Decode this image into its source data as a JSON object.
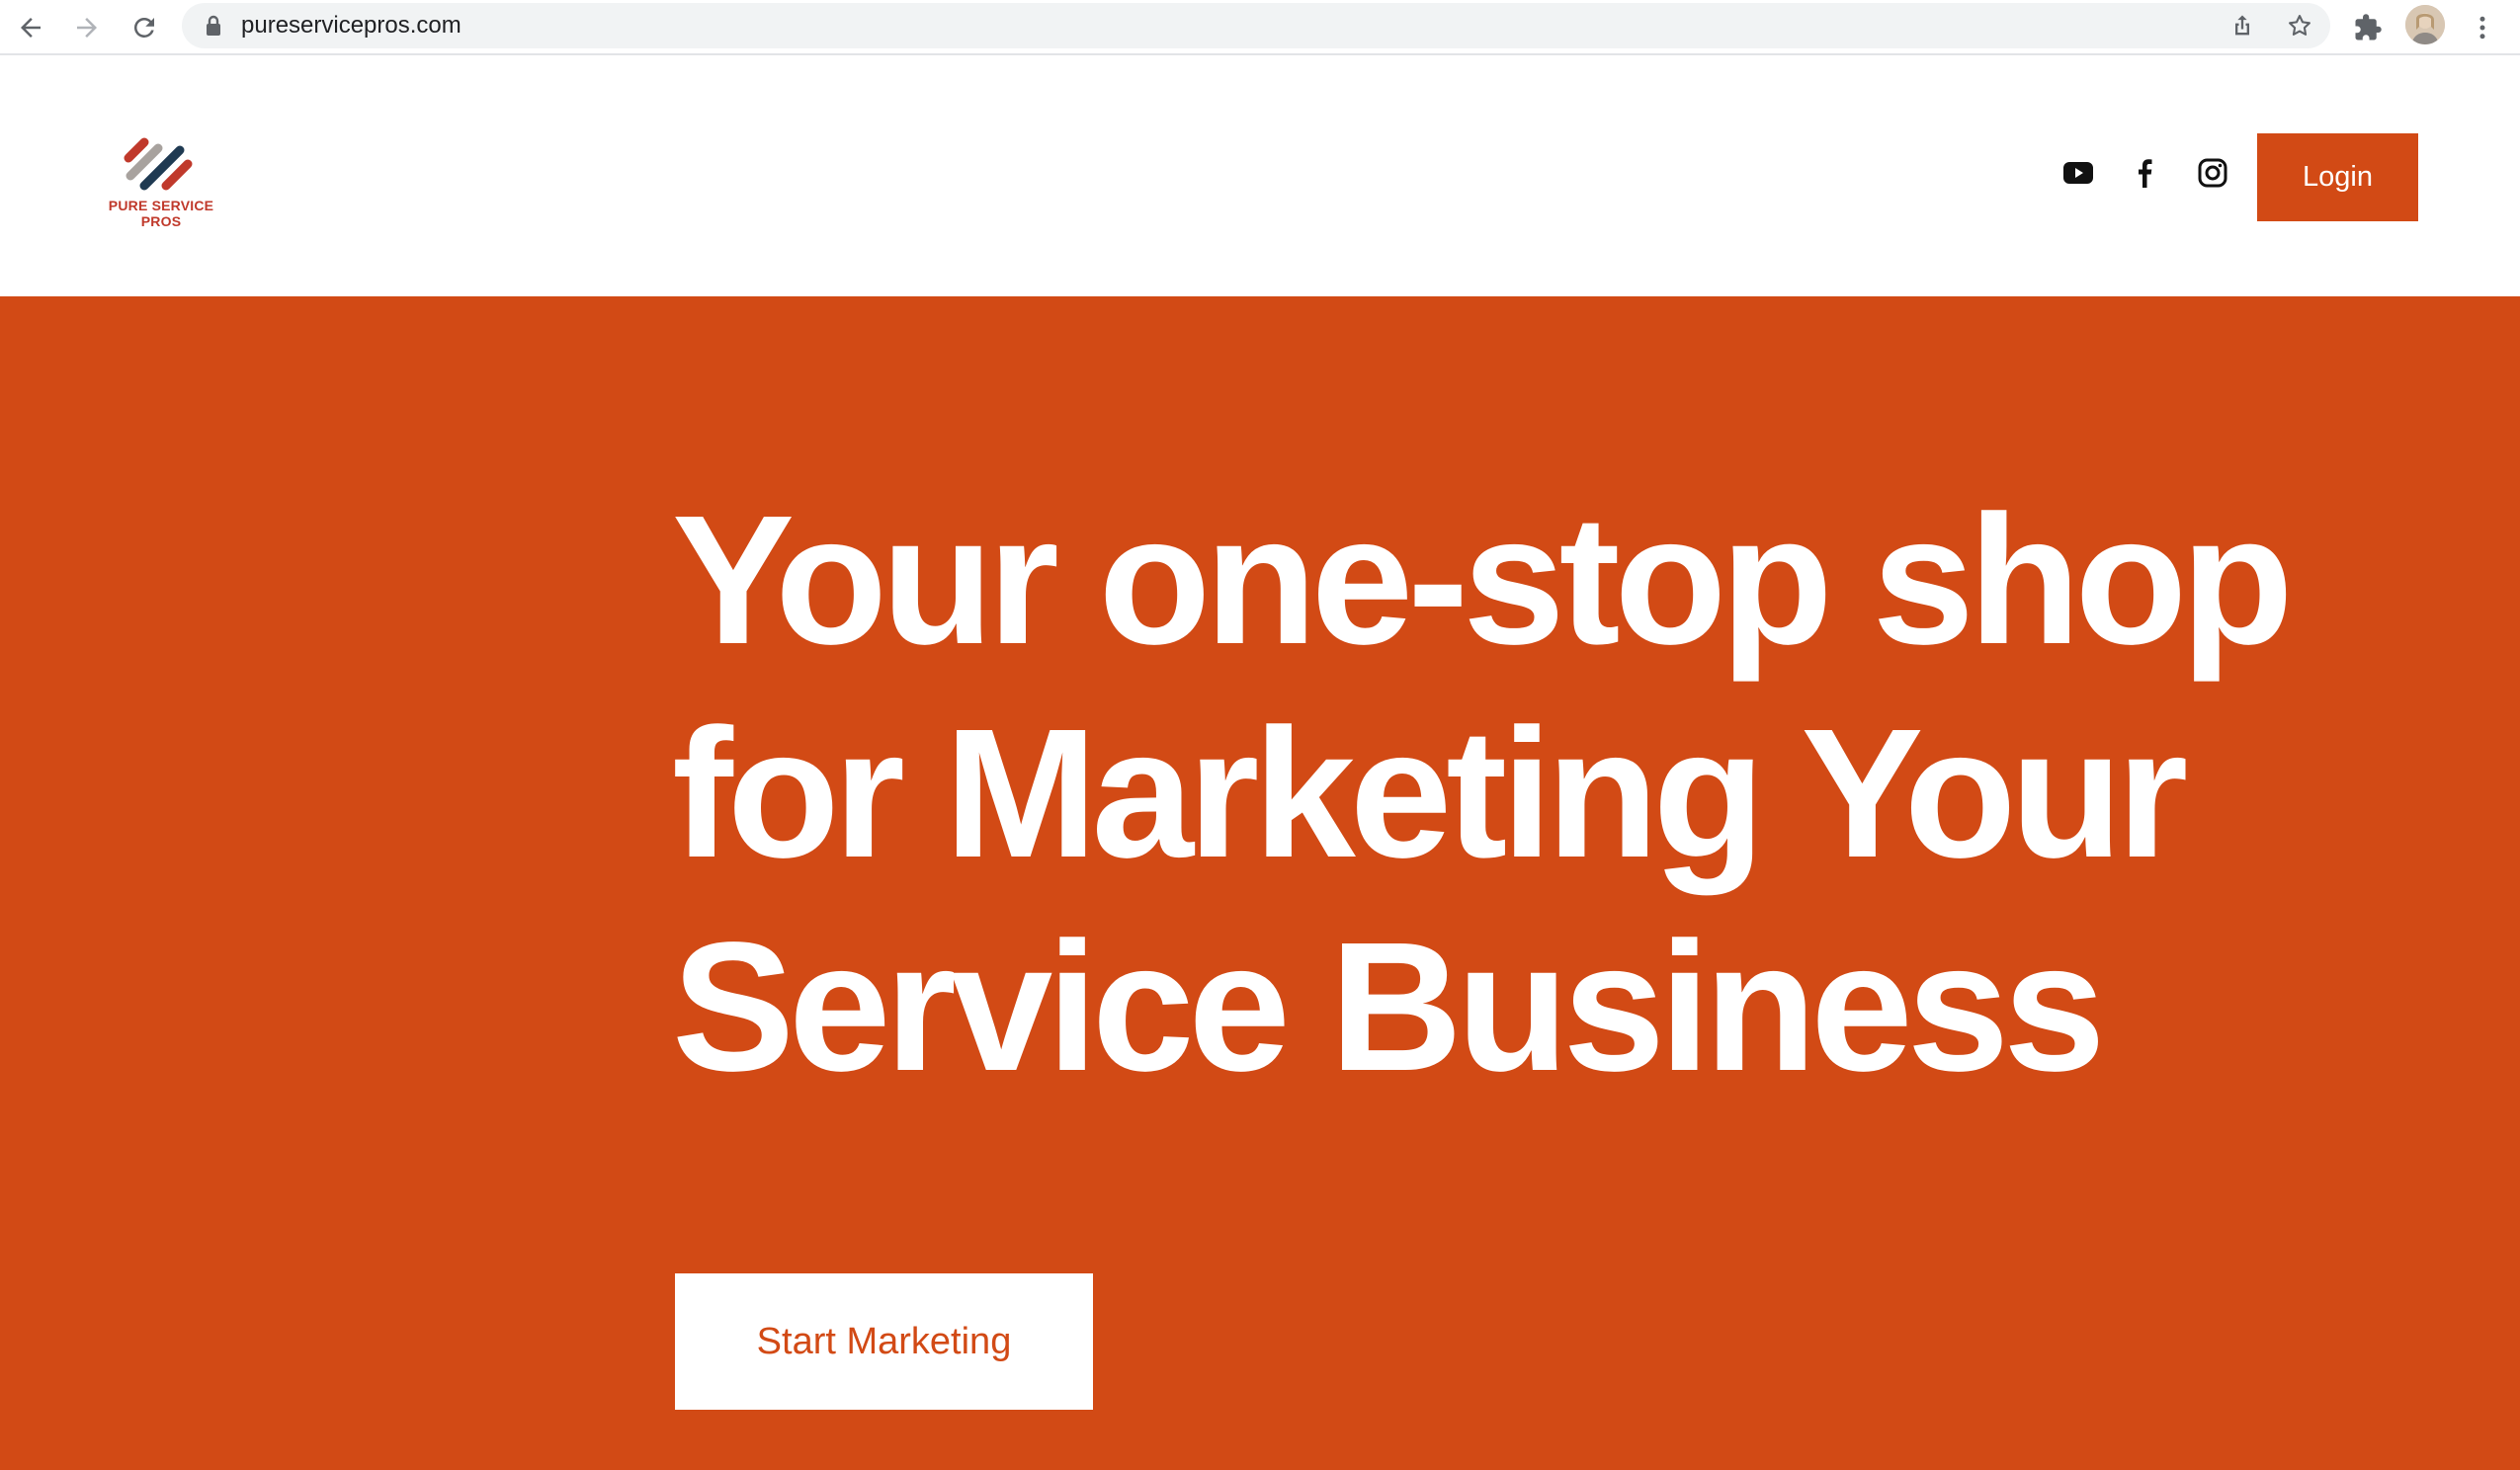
{
  "browser": {
    "url": "pureservicepros.com",
    "icons": {
      "back": "arrow-left-icon",
      "forward": "arrow-right-icon",
      "reload": "reload-icon",
      "lock": "lock-icon",
      "share": "share-icon",
      "bookmark": "star-icon",
      "extensions": "puzzle-icon",
      "menu": "kebab-menu-icon"
    }
  },
  "header": {
    "logo_text": "PURE SERVICE PROS",
    "social": [
      "youtube-icon",
      "facebook-icon",
      "instagram-icon"
    ],
    "login_label": "Login"
  },
  "hero": {
    "title_lines": [
      "Your one-stop shop",
      "for Marketing Your",
      "Service Business"
    ],
    "cta_label": "Start Marketing"
  },
  "colors": {
    "accent": "#d24a15",
    "text_on_accent": "#ffffff",
    "logo_red": "#c0392b",
    "logo_navy": "#1f3a52",
    "logo_gray": "#a8a29e"
  }
}
